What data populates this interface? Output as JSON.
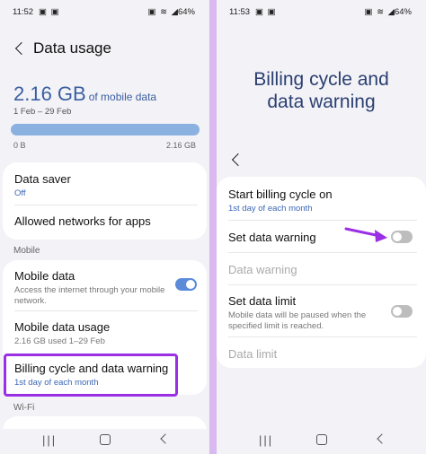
{
  "left": {
    "status": {
      "time": "11:52",
      "left_icons": "▣ ▣",
      "right_icons": "▣ ≋ ◢",
      "battery": "64%"
    },
    "header": {
      "title": "Data usage"
    },
    "usage": {
      "amount": "2.16 GB",
      "suffix": "of mobile data",
      "range": "1 Feb – 29 Feb",
      "bar_min": "0 B",
      "bar_max": "2.16 GB",
      "fill_percent": 100
    },
    "card1": {
      "data_saver_title": "Data saver",
      "data_saver_sub": "Off",
      "allowed_networks": "Allowed networks for apps"
    },
    "section_mobile": "Mobile",
    "card2": {
      "mobile_data_title": "Mobile data",
      "mobile_data_sub": "Access the internet through your mobile network.",
      "mobile_data_on": true,
      "mobile_usage_title": "Mobile data usage",
      "mobile_usage_sub": "2.16 GB used 1–29 Feb",
      "billing_title": "Billing cycle and data warning",
      "billing_sub": "1st day of each month"
    },
    "section_wifi": "Wi-Fi"
  },
  "right": {
    "status": {
      "time": "11:53",
      "left_icons": "▣ ▣",
      "right_icons": "▣ ≋ ◢",
      "battery": "64%"
    },
    "big_title_line1": "Billing cycle and",
    "big_title_line2": "data warning",
    "card": {
      "start_title": "Start billing cycle on",
      "start_sub": "1st day of each month",
      "set_warning_title": "Set data warning",
      "set_warning_on": false,
      "data_warning_title": "Data warning",
      "set_limit_title": "Set data limit",
      "set_limit_sub": "Mobile data will be paused when the specified limit is reached.",
      "set_limit_on": false,
      "data_limit_title": "Data limit"
    }
  },
  "colors": {
    "accent": "#5b8bd9",
    "highlight": "#9a2fe3",
    "title_blue": "#2a3e70",
    "background": "#f2f2f7"
  },
  "nav": {
    "recent": "|||"
  }
}
